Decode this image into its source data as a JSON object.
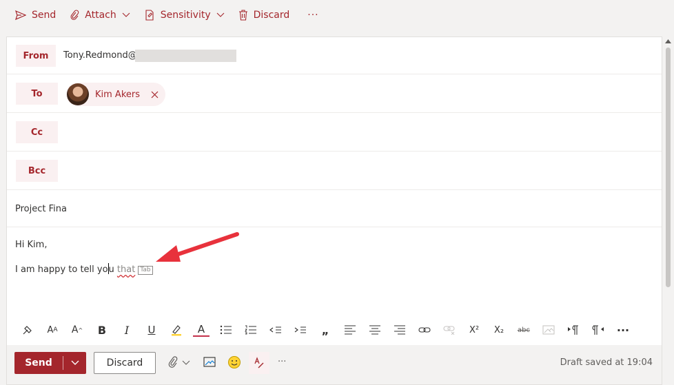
{
  "toolbar": {
    "send": "Send",
    "attach": "Attach",
    "sensitivity": "Sensitivity",
    "discard": "Discard",
    "more": "···"
  },
  "header": {
    "from_label": "From",
    "from_value": "Tony.Redmond@",
    "to_label": "To",
    "recipient_name": "Kim Akers",
    "cc_label": "Cc",
    "bcc_label": "Bcc"
  },
  "subject": "Project Fina",
  "body": {
    "greeting": "Hi Kim,",
    "typed_before_cursor": "I am happy to tell yo",
    "typed_after_cursor": "u ",
    "suggestion": "that",
    "tab_hint": "Tab"
  },
  "format_toolbar": {
    "icons": [
      "format-painter-icon",
      "font-size-decrease-icon",
      "font-size-increase-icon",
      "bold-icon",
      "italic-icon",
      "underline-icon",
      "highlight-icon",
      "font-color-icon",
      "bullets-icon",
      "numbering-icon",
      "decrease-indent-icon",
      "increase-indent-icon",
      "quote-icon",
      "align-left-icon",
      "align-center-icon",
      "align-right-icon",
      "link-icon",
      "remove-link-icon",
      "superscript-icon",
      "subscript-icon",
      "strikethrough-icon",
      "insert-picture-icon",
      "ltr-icon",
      "rtl-icon",
      "more-options-icon"
    ],
    "bold": "B",
    "italic": "I",
    "underline": "U",
    "font_color": "A",
    "quote": "„",
    "superscript": "X²",
    "subscript": "X₂",
    "strike": "abc",
    "more": "···"
  },
  "bottom": {
    "send": "Send",
    "discard": "Discard",
    "more": "···",
    "status": "Draft saved at 19:04"
  },
  "colors": {
    "accent": "#a4262c",
    "accent_light": "#faf0f1",
    "annotation_arrow": "#e8323c"
  }
}
